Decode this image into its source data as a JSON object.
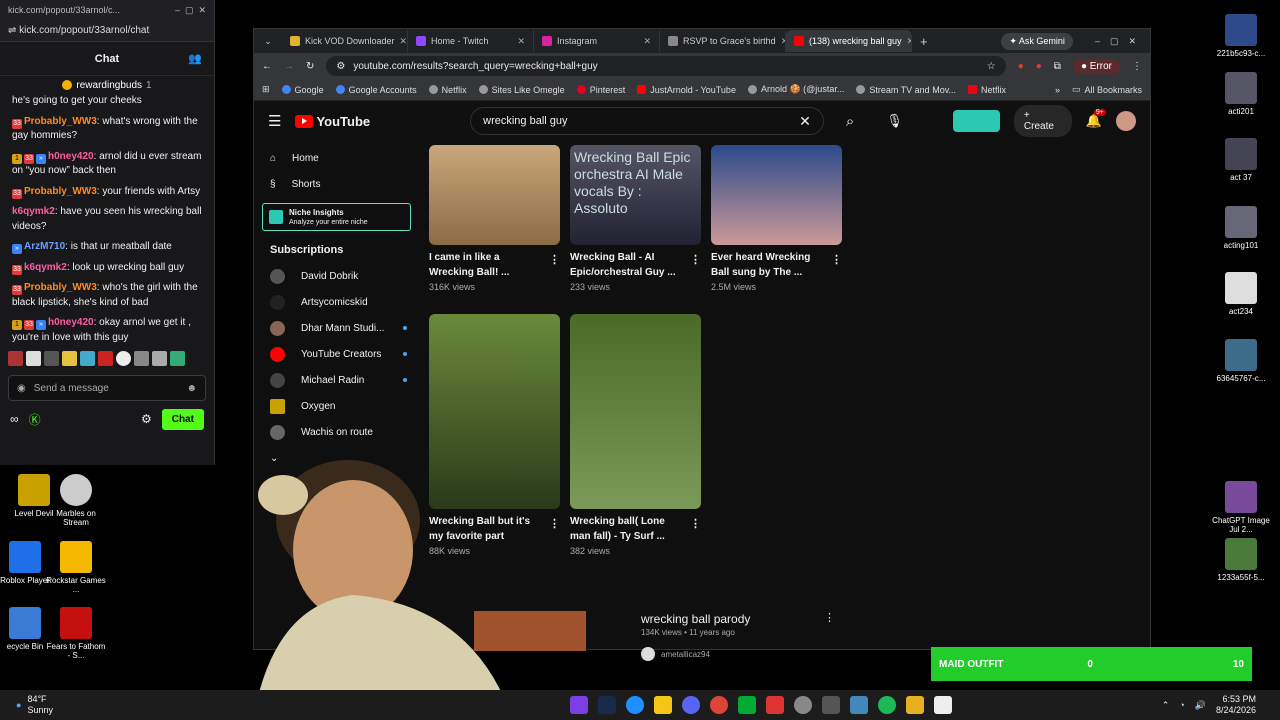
{
  "chat_window": {
    "title": "kick.com/popout/33arnol/c...",
    "url": "kick.com/popout/33arnol/chat",
    "header": "Chat",
    "pinned_user": "rewardingbuds",
    "pinned_count": "1",
    "messages": [
      {
        "user": "",
        "text": "he's going to get your cheeks"
      },
      {
        "user": "Probably_WW3",
        "text": ": what's wrong with the gay hommies?"
      },
      {
        "user": "h0ney420",
        "text": ": arnol did u ever stream on “you now” back then"
      },
      {
        "user": "Probably_WW3",
        "text": ": your friends with Artsy"
      },
      {
        "user": "k6qymk2",
        "text": ": have you seen his wrecking ball videos?"
      },
      {
        "user": "ArzM710",
        "text": ": is that ur meatball date"
      },
      {
        "user": "k6qymk2",
        "text": ": look up wrecking ball guy"
      },
      {
        "user": "Probably_WW3",
        "text": ": who's the girl with the black lipstick, she's kind of bad"
      },
      {
        "user": "h0ney420",
        "text": ": okay arnol we get it , you're in love with this guy"
      }
    ],
    "input_placeholder": "Send a message",
    "chat_button": "Chat"
  },
  "browser": {
    "tabs": [
      {
        "label": "Kick VOD Downloader",
        "color": "#e2b22a"
      },
      {
        "label": "Home - Twitch",
        "color": "#9146ff"
      },
      {
        "label": "Instagram",
        "color": "#d6249f"
      },
      {
        "label": "RSVP to Grace's birthd",
        "color": "#888888"
      },
      {
        "label": "(138) wrecking ball guy",
        "color": "#ff0000"
      }
    ],
    "ask_gemini": "Ask Gemini",
    "url": "youtube.com/results?search_query=wrecking+ball+guy",
    "error_label": "Error",
    "bookmarks": [
      "Google",
      "Google Accounts",
      "Netflix",
      "Sites Like Omegle",
      "Pinterest",
      "JustArnold - YouTube",
      "Arnold 🍪 (@justar...",
      "Stream TV and Mov...",
      "Netflix"
    ],
    "all_bookmarks": "All Bookmarks"
  },
  "youtube": {
    "logo": "YouTube",
    "search_value": "wrecking ball guy",
    "create": "Create",
    "notif_count": "9+",
    "nav": [
      "Home",
      "Shorts"
    ],
    "niche_title": "Niche Insights",
    "niche_sub": "Analyze your entire niche",
    "subscriptions_label": "Subscriptions",
    "subscriptions": [
      "David Dobrik",
      "Artsycomicskid",
      "Dhar Mann Studi...",
      "YouTube Creators",
      "Michael Radin",
      "Oxygen",
      "Wachis on route"
    ],
    "videos": [
      {
        "title": "I came in like a Wrecking Ball! ...",
        "views": "316K views"
      },
      {
        "title": "Wrecking Ball - AI Epic/orchestral Guy ...",
        "views": "233 views"
      },
      {
        "title": "Ever heard Wrecking Ball sung by The ...",
        "views": "2.5M views"
      },
      {
        "title": "Wrecking Ball but it's my favorite part",
        "views": "88K views"
      },
      {
        "title": "Wrecking ball( Lone man fall) - Ty Surf ...",
        "views": "382 views"
      }
    ],
    "thumb_text": "Wrecking Ball Epic orchestra AI Male vocals By : Assoluto",
    "list_video": {
      "title": "wrecking ball parody",
      "meta": "134K views • 11 years ago",
      "channel": "ametallicaz94"
    }
  },
  "desktop_icons_left": [
    "Level Devil",
    "Marbles on Stream",
    "Roblox Player",
    "Rockstar Games ...",
    "ecycle Bin",
    "Fears to Fathom - S..."
  ],
  "desktop_icons_right": [
    "221b5c93-c...",
    "acti201",
    "act 37",
    "acting101",
    "act234",
    "63645767-c...",
    "ChatGPT Image Jul 2...",
    "1233a55f-5..."
  ],
  "overlay": {
    "label": "MAID OUTFIT",
    "current": "0",
    "goal": "10",
    "progress": 0.0
  },
  "taskbar": {
    "weather_temp": "84°F",
    "weather_desc": "Sunny",
    "time": "6:53 PM",
    "date": "8/24/2026"
  }
}
